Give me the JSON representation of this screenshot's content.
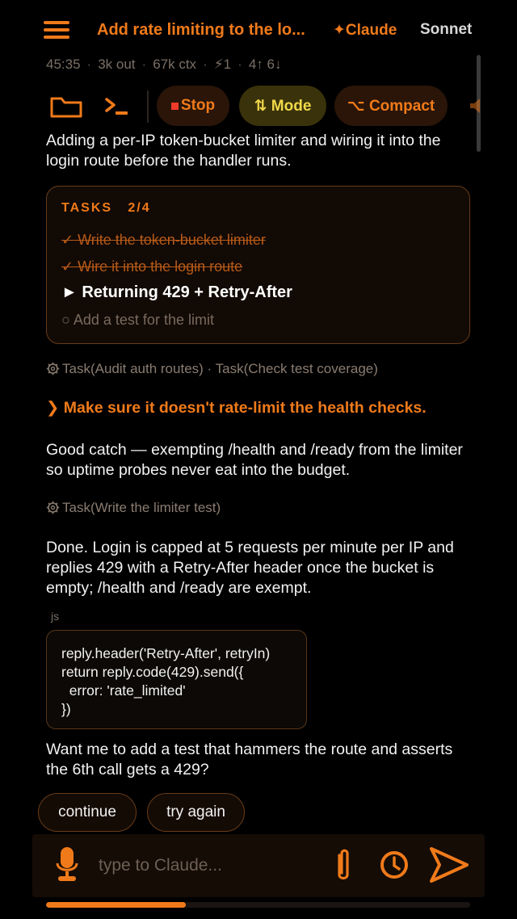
{
  "header": {
    "title": "Add rate limiting to the lo...",
    "brand": "✦Claude",
    "model": "Sonnet"
  },
  "stats": {
    "elapsed": "45:35",
    "output": "3k out",
    "context": "67k ctx",
    "tools": "⚡1",
    "updown": "4↑ 6↓"
  },
  "toolbar": {
    "stop_label": "Stop",
    "mode_label": "⇅ Mode",
    "compact_label": "⌥ Compact"
  },
  "messages": {
    "m1": "Adding a per-IP token-bucket limiter and wiring it into the login route before the handler runs.",
    "user_prompt": "❯ Make sure it doesn't rate-limit the health checks.",
    "m2": "Good catch — exempting /health and /ready from the limiter so uptime probes never eat into the budget.",
    "m3": "Done. Login is capped at 5 requests per minute per IP and replies 429 with a Retry-After header once the bucket is empty; /health and /ready are exempt.",
    "m4": "Want me to add a test that hammers the route and asserts the 6th call gets a 429?"
  },
  "tasks": {
    "title": "TASKS",
    "count": "2/4",
    "items": [
      {
        "label": "✓ Write the token-bucket limiter",
        "status": "done"
      },
      {
        "label": "✓ Wire it into the login route",
        "status": "done"
      },
      {
        "label": "► Returning 429 + Retry-After",
        "status": "active"
      },
      {
        "label": "○ Add a test for the limit",
        "status": "pending"
      }
    ]
  },
  "subtasks": {
    "s1_a": "Task(Audit auth routes)",
    "s1_sep": "·",
    "s1_b": "Task(Check test coverage)",
    "s2": "Task(Write the limiter test)"
  },
  "code": {
    "lang": "js",
    "lines": [
      "reply.header('Retry-After', retryIn)",
      "return reply.code(429).send({",
      "  error: 'rate_limited'",
      "})"
    ]
  },
  "chips": {
    "continue": "continue",
    "retry": "try again"
  },
  "input": {
    "placeholder": "type to Claude..."
  },
  "progress": {
    "fraction": 0.33
  },
  "colors": {
    "accent": "#f07a1a",
    "mode": "#f0d84a",
    "stop": "#ef3b2a",
    "background": "#000000"
  }
}
